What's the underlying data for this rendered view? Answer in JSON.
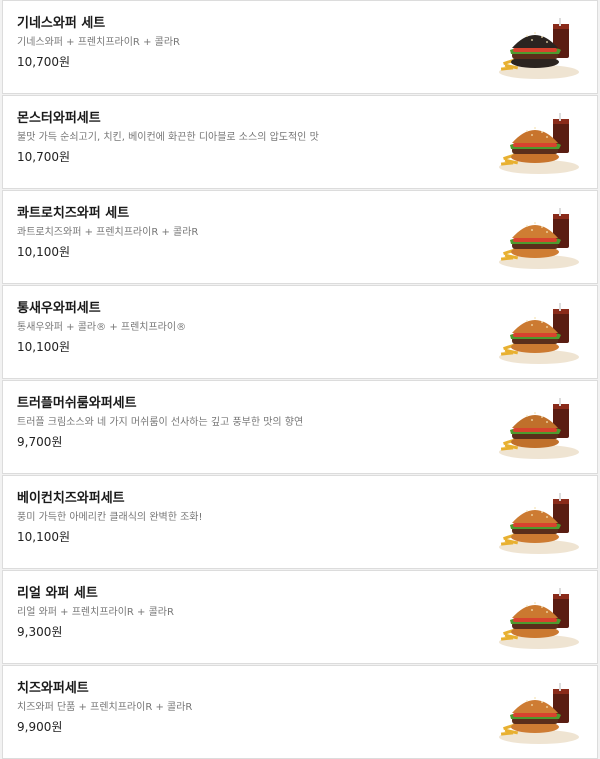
{
  "menu": {
    "items": [
      {
        "name": "기네스와퍼 세트",
        "desc": "기네스와퍼 + 프렌치프라이R + 콜라R",
        "price": "10,700원",
        "image": "guinness-whopper-set",
        "bun": "#2b2420"
      },
      {
        "name": "몬스터와퍼세트",
        "desc": "불맛 가득 순쇠고기, 치킨, 베이컨에 화끈한 디아블로 소스의 압도적인 맛",
        "price": "10,700원",
        "image": "monster-whopper-set",
        "bun": "#c8742c"
      },
      {
        "name": "콰트로치즈와퍼 세트",
        "desc": "콰트로치즈와퍼 + 프렌치프라이R + 콜라R",
        "price": "10,100원",
        "image": "quattro-cheese-whopper-set",
        "bun": "#cf7d33"
      },
      {
        "name": "통새우와퍼세트",
        "desc": "통새우와퍼 + 콜라® + 프렌치프라이®",
        "price": "10,100원",
        "image": "shrimp-whopper-set",
        "bun": "#cc7a31"
      },
      {
        "name": "트러플머쉬룸와퍼세트",
        "desc": "트러플 크림소스와 네 가지 머쉬룸이 선사하는 깊고 풍부한 맛의 향연",
        "price": "9,700원",
        "image": "truffle-mushroom-whopper-set",
        "bun": "#c0702b"
      },
      {
        "name": "베이컨치즈와퍼세트",
        "desc": "풍미 가득한 아메리칸 클래식의 완벽한 조화!",
        "price": "10,100원",
        "image": "bacon-cheese-whopper-set",
        "bun": "#cd7b32"
      },
      {
        "name": "리얼 와퍼 세트",
        "desc": "리얼 와퍼  +  프렌치프라이R  +  콜라R",
        "price": "9,300원",
        "image": "real-whopper-set",
        "bun": "#cb7930"
      },
      {
        "name": "치즈와퍼세트",
        "desc": "치즈와퍼 단품 + 프렌치프라이R + 콜라R",
        "price": "9,900원",
        "image": "cheese-whopper-set",
        "bun": "#ce7c33"
      }
    ]
  }
}
